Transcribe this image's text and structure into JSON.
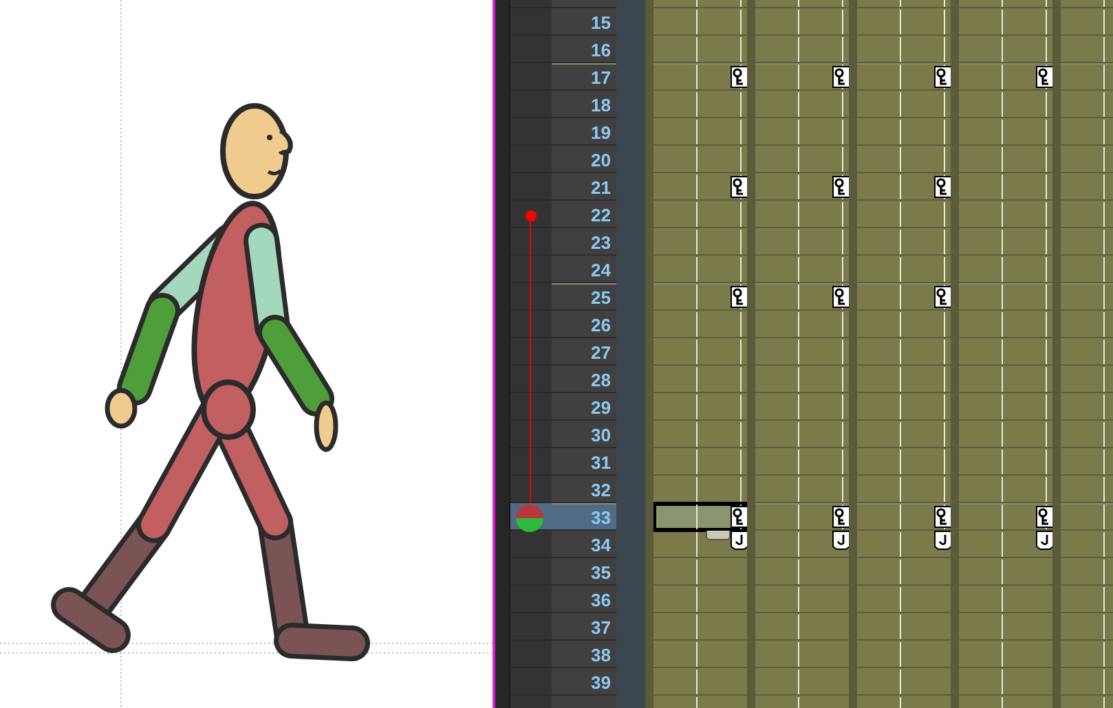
{
  "xsheet": {
    "frames": [
      {
        "number": "15",
        "current": false,
        "onion_mark": false
      },
      {
        "number": "16",
        "current": false,
        "onion_mark": false
      },
      {
        "number": "17",
        "current": false,
        "onion_mark": false
      },
      {
        "number": "18",
        "current": false,
        "onion_mark": false
      },
      {
        "number": "19",
        "current": false,
        "onion_mark": false
      },
      {
        "number": "20",
        "current": false,
        "onion_mark": false
      },
      {
        "number": "21",
        "current": false,
        "onion_mark": false
      },
      {
        "number": "22",
        "current": false,
        "onion_mark": true
      },
      {
        "number": "23",
        "current": false,
        "onion_mark": false
      },
      {
        "number": "24",
        "current": false,
        "onion_mark": false
      },
      {
        "number": "25",
        "current": false,
        "onion_mark": false
      },
      {
        "number": "26",
        "current": false,
        "onion_mark": false
      },
      {
        "number": "27",
        "current": false,
        "onion_mark": false
      },
      {
        "number": "28",
        "current": false,
        "onion_mark": false
      },
      {
        "number": "29",
        "current": false,
        "onion_mark": false
      },
      {
        "number": "30",
        "current": false,
        "onion_mark": false
      },
      {
        "number": "31",
        "current": false,
        "onion_mark": false
      },
      {
        "number": "32",
        "current": false,
        "onion_mark": false
      },
      {
        "number": "33",
        "current": true,
        "onion_mark": false
      },
      {
        "number": "34",
        "current": false,
        "onion_mark": false
      },
      {
        "number": "35",
        "current": false,
        "onion_mark": false
      },
      {
        "number": "36",
        "current": false,
        "onion_mark": false
      },
      {
        "number": "37",
        "current": false,
        "onion_mark": false
      },
      {
        "number": "38",
        "current": false,
        "onion_mark": false
      },
      {
        "number": "39",
        "current": false,
        "onion_mark": false
      }
    ],
    "columns": [
      {
        "selected": true,
        "key": [
          false,
          false,
          true,
          false,
          false,
          false,
          true,
          false,
          false,
          false,
          true,
          false,
          false,
          false,
          false,
          false,
          false,
          false,
          true,
          false,
          false,
          false,
          false,
          false,
          false
        ],
        "cycle": [
          false,
          false,
          false,
          false,
          false,
          false,
          false,
          false,
          false,
          false,
          false,
          false,
          false,
          false,
          false,
          false,
          false,
          false,
          false,
          true,
          false,
          false,
          false,
          false,
          false
        ]
      },
      {
        "selected": false,
        "key": [
          false,
          false,
          true,
          false,
          false,
          false,
          true,
          false,
          false,
          false,
          true,
          false,
          false,
          false,
          false,
          false,
          false,
          false,
          true,
          false,
          false,
          false,
          false,
          false,
          false
        ],
        "cycle": [
          false,
          false,
          false,
          false,
          false,
          false,
          false,
          false,
          false,
          false,
          false,
          false,
          false,
          false,
          false,
          false,
          false,
          false,
          false,
          true,
          false,
          false,
          false,
          false,
          false
        ]
      },
      {
        "selected": false,
        "key": [
          false,
          false,
          true,
          false,
          false,
          false,
          true,
          false,
          false,
          false,
          true,
          false,
          false,
          false,
          false,
          false,
          false,
          false,
          true,
          false,
          false,
          false,
          false,
          false,
          false
        ],
        "cycle": [
          false,
          false,
          false,
          false,
          false,
          false,
          false,
          false,
          false,
          false,
          false,
          false,
          false,
          false,
          false,
          false,
          false,
          false,
          false,
          true,
          false,
          false,
          false,
          false,
          false
        ]
      },
      {
        "selected": false,
        "key": [
          false,
          false,
          true,
          false,
          false,
          false,
          false,
          false,
          false,
          false,
          false,
          false,
          false,
          false,
          false,
          false,
          false,
          false,
          true,
          false,
          false,
          false,
          false,
          false,
          false
        ],
        "cycle": [
          false,
          false,
          false,
          false,
          false,
          false,
          false,
          false,
          false,
          false,
          false,
          false,
          false,
          false,
          false,
          false,
          false,
          false,
          false,
          true,
          false,
          false,
          false,
          false,
          false
        ]
      }
    ]
  }
}
